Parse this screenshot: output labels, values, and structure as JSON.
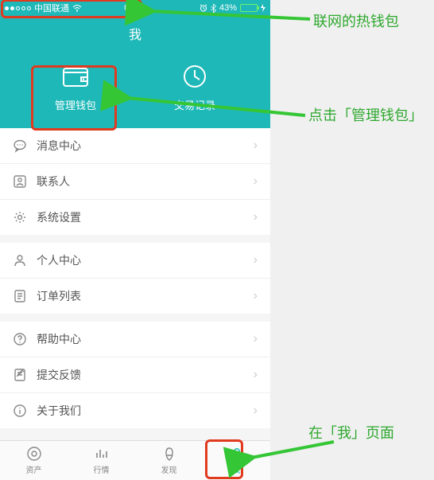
{
  "status": {
    "carrier": "中国联通",
    "time": "00:23",
    "battery_pct": "43%"
  },
  "header": {
    "title": "我",
    "wallet_label": "管理钱包",
    "history_label": "交易记录"
  },
  "list1": [
    {
      "icon": "message-icon",
      "label": "消息中心"
    },
    {
      "icon": "contacts-icon",
      "label": "联系人"
    },
    {
      "icon": "settings-icon",
      "label": "系统设置"
    }
  ],
  "list2": [
    {
      "icon": "user-icon",
      "label": "个人中心"
    },
    {
      "icon": "orders-icon",
      "label": "订单列表"
    }
  ],
  "list3": [
    {
      "icon": "help-icon",
      "label": "帮助中心"
    },
    {
      "icon": "feedback-icon",
      "label": "提交反馈"
    },
    {
      "icon": "about-icon",
      "label": "关于我们"
    }
  ],
  "tabs": [
    {
      "label": "资产"
    },
    {
      "label": "行情"
    },
    {
      "label": "发现"
    },
    {
      "label": "我"
    }
  ],
  "annotations": {
    "a1": "联网的热钱包",
    "a2": "点击「管理钱包」",
    "a3": "在「我」页面"
  }
}
